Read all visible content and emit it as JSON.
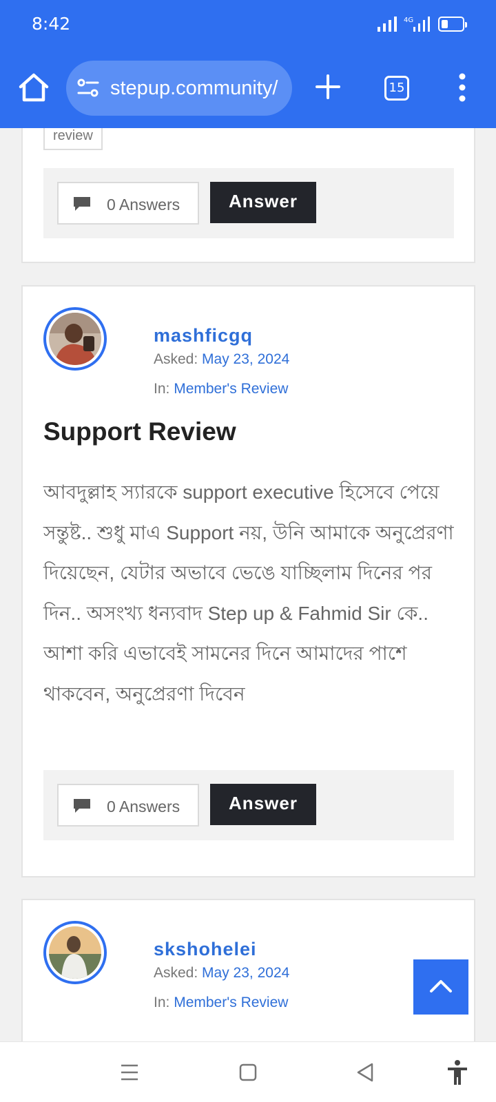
{
  "status_bar": {
    "time": "8:42",
    "network_label": "4G"
  },
  "browser": {
    "url": "stepup.community/",
    "tab_count": "15"
  },
  "cards": [
    {
      "tag": "review",
      "answers": "0 Answers",
      "answer_label": "Answer"
    },
    {
      "author": "mashficgq",
      "asked_label": "Asked:",
      "asked_date": "May 23, 2024",
      "in_label": "In:",
      "category": "Member's Review",
      "title": "Support Review",
      "body": "আবদুল্লাহ স্যারকে support executive হিসেবে পেয়ে সন্তুষ্ট.. শুধু মাএ Support নয়, উনি আমাকে অনুপ্রেরণা দিয়েছেন, যেটার অভাবে ভেঙে যাচ্ছিলাম দিনের পর দিন.. অসংখ্য ধন্যবাদ Step up & Fahmid Sir কে.. আশা করি এভাবেই সামনের দিনে আমাদের পাশে থাকবেন, অনুপ্রেরণা দিবেন",
      "answers": "0 Answers",
      "answer_label": "Answer"
    },
    {
      "author": "skshohelei",
      "asked_label": "Asked:",
      "asked_date": "May 23, 2024",
      "in_label": "In:",
      "category": "Member's Review"
    }
  ],
  "colors": {
    "accent": "#2f6ff0",
    "link": "#2f6fd8",
    "button_dark": "#23252b"
  },
  "icons": [
    "home-icon",
    "site-settings-icon",
    "plus-icon",
    "tabs-icon",
    "more-vert-icon",
    "comment-icon",
    "chevron-up-icon",
    "recents-icon",
    "home-square-icon",
    "back-icon",
    "accessibility-icon"
  ]
}
